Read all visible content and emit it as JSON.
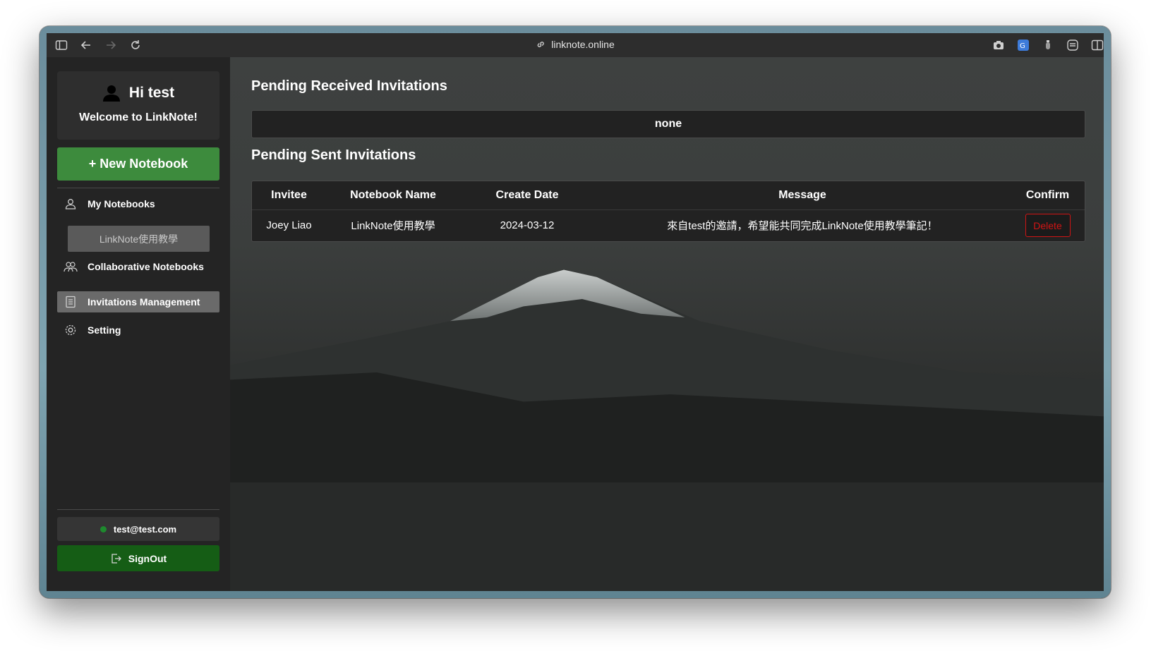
{
  "browser": {
    "url": "linknote.online"
  },
  "sidebar": {
    "greeting": "Hi test",
    "welcome": "Welcome to LinkNote!",
    "new_notebook_label": "+ New Notebook",
    "items": [
      {
        "label": "My Notebooks",
        "icon": "user-icon"
      },
      {
        "label": "Collaborative Notebooks",
        "icon": "users-icon"
      },
      {
        "label": "Invitations Management",
        "icon": "document-icon"
      },
      {
        "label": "Setting",
        "icon": "gear-icon"
      }
    ],
    "notebooks": [
      "LinkNote使用教學"
    ],
    "email": "test@test.com",
    "signout_label": "SignOut"
  },
  "main": {
    "received_title": "Pending Received Invitations",
    "received_empty": "none",
    "sent_title": "Pending Sent Invitations",
    "table": {
      "headers": [
        "Invitee",
        "Notebook Name",
        "Create Date",
        "Message",
        "Confirm"
      ],
      "rows": [
        {
          "invitee": "Joey Liao",
          "notebook": "LinkNote使用教學",
          "date": "2024-03-12",
          "message": "來自test的邀請，希望能共同完成LinkNote使用教學筆記！",
          "action": "Delete"
        }
      ]
    }
  },
  "colors": {
    "accent_green": "#3d8b3d",
    "signout_green": "#155d15",
    "delete_red": "#d01414"
  }
}
